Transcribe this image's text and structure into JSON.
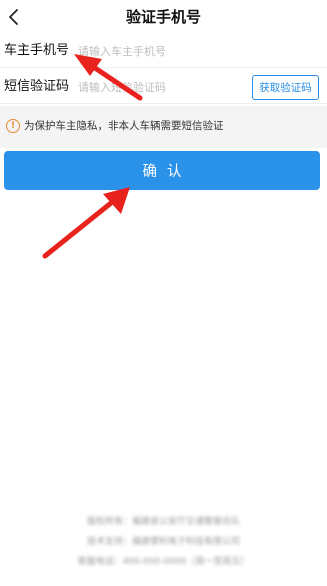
{
  "header": {
    "title": "验证手机号",
    "back_icon": "chevron-left-icon"
  },
  "form": {
    "phone": {
      "label": "车主手机号",
      "placeholder": "请输入车主手机号",
      "value": ""
    },
    "code": {
      "label": "短信验证码",
      "placeholder": "请输入短信验证码",
      "value": "",
      "get_code_label": "获取验证码"
    }
  },
  "notice": {
    "icon": "exclamation-circle-icon",
    "text": "为保护车主隐私，非本人车辆需要短信验证"
  },
  "confirm": {
    "label": "确认"
  },
  "footer": {
    "lines": [
      "版权所有：福建省公安厅交通警察总队",
      "技术支持：福建便利电子科技有限公司",
      "客服电话：400-000-0000（周一至周五）"
    ]
  },
  "colors": {
    "primary": "#2b92ea",
    "warning": "#e68a2e",
    "annotation_arrow": "#e8221c"
  }
}
